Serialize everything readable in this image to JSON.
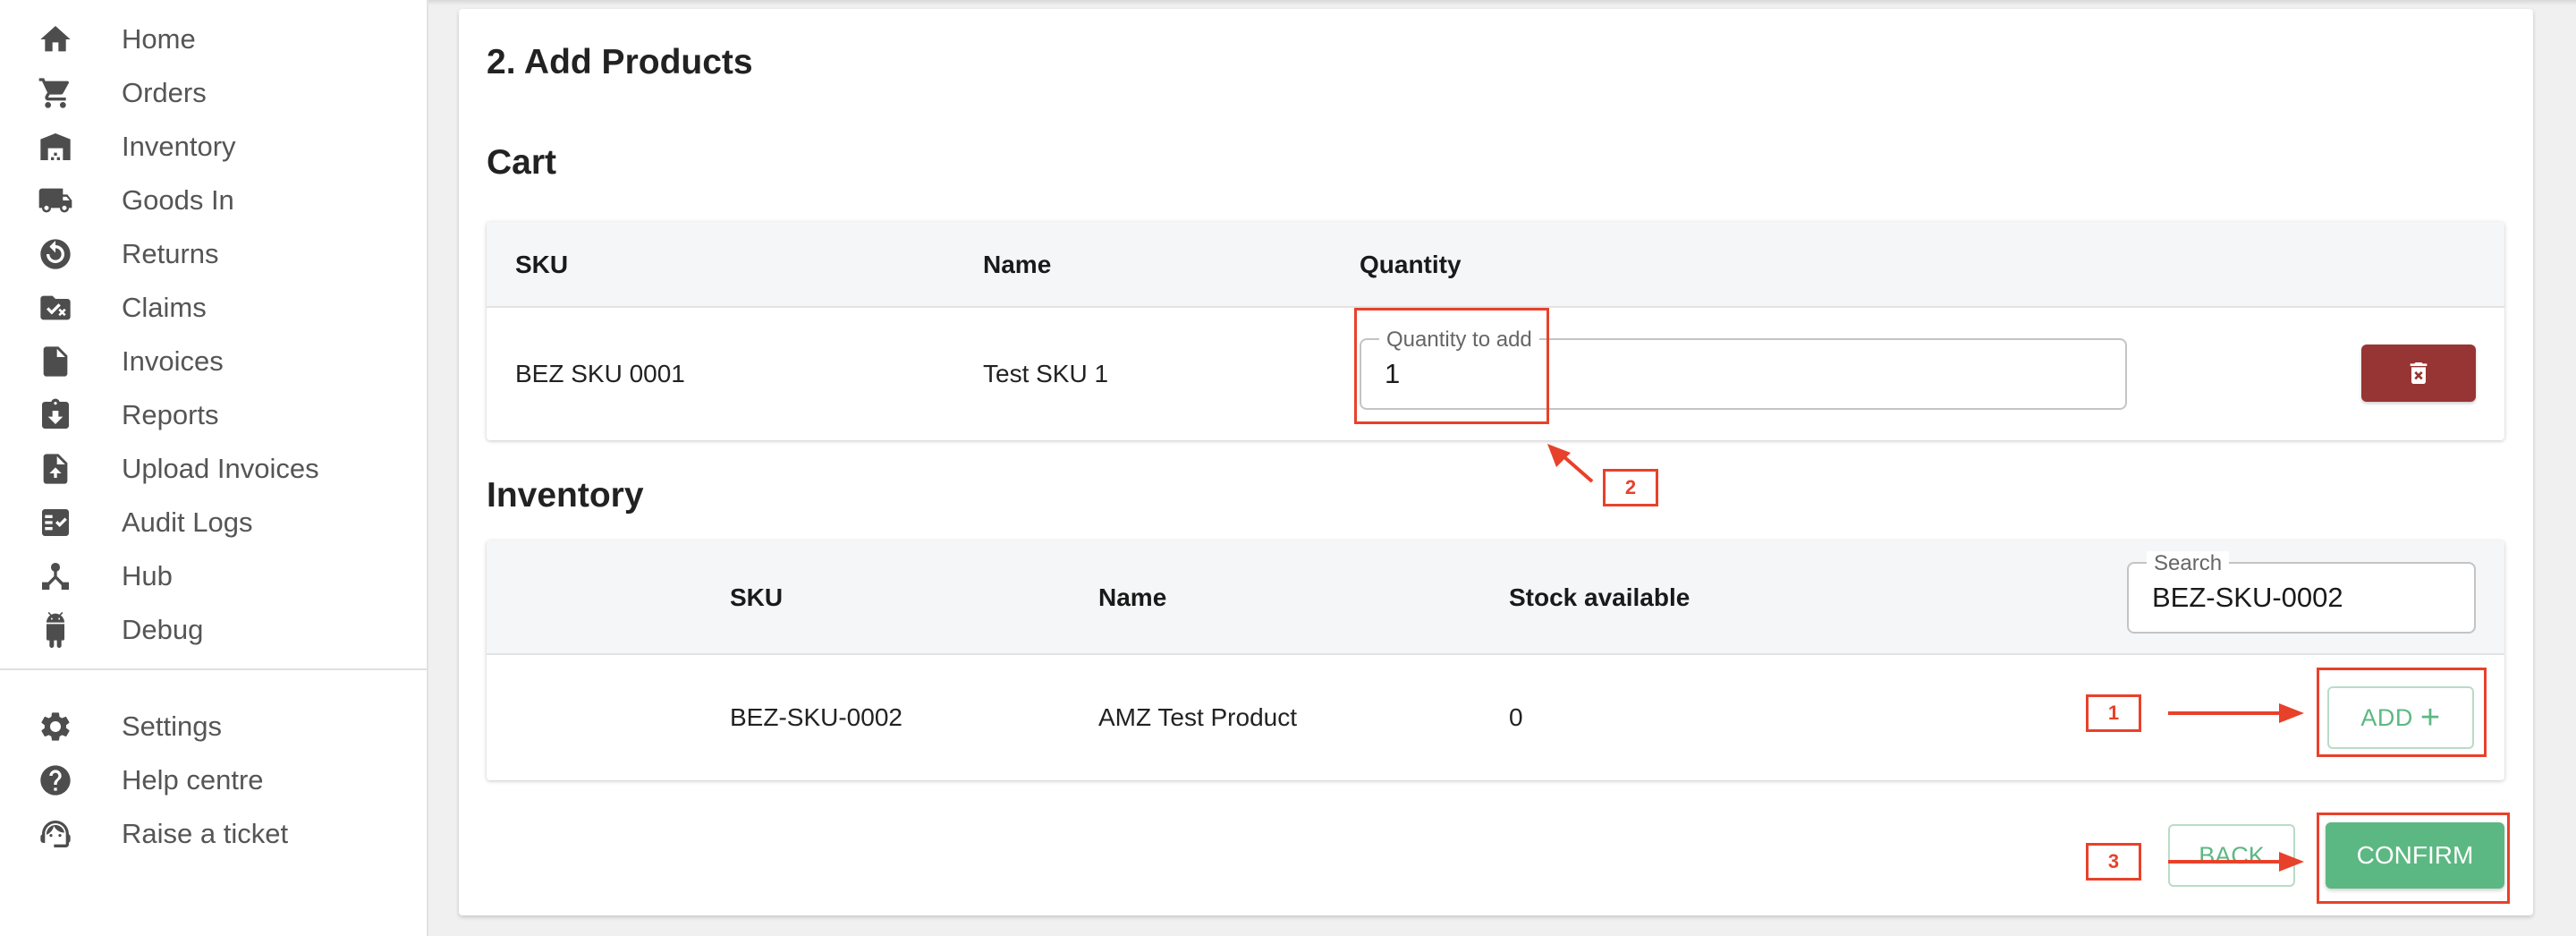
{
  "sidebar": {
    "items": [
      {
        "label": "Home",
        "icon": "home-icon"
      },
      {
        "label": "Orders",
        "icon": "cart-icon"
      },
      {
        "label": "Inventory",
        "icon": "warehouse-icon"
      },
      {
        "label": "Goods In",
        "icon": "truck-icon"
      },
      {
        "label": "Returns",
        "icon": "returns-icon"
      },
      {
        "label": "Claims",
        "icon": "claims-folder-icon"
      },
      {
        "label": "Invoices",
        "icon": "document-icon"
      },
      {
        "label": "Reports",
        "icon": "clipboard-download-icon"
      },
      {
        "label": "Upload Invoices",
        "icon": "file-upload-icon"
      },
      {
        "label": "Audit Logs",
        "icon": "checklist-icon"
      },
      {
        "label": "Hub",
        "icon": "hub-icon"
      },
      {
        "label": "Debug",
        "icon": "android-icon"
      }
    ],
    "secondary_items": [
      {
        "label": "Settings",
        "icon": "gear-icon"
      },
      {
        "label": "Help centre",
        "icon": "help-icon"
      },
      {
        "label": "Raise a ticket",
        "icon": "support-agent-icon"
      }
    ]
  },
  "main": {
    "step_title": "2. Add Products",
    "cart": {
      "title": "Cart",
      "columns": [
        "SKU",
        "Name",
        "Quantity"
      ],
      "rows": [
        {
          "sku": "BEZ SKU 0001",
          "name": "Test SKU 1",
          "quantity_label": "Quantity to add",
          "quantity_value": "1"
        }
      ]
    },
    "inventory": {
      "title": "Inventory",
      "columns": [
        "SKU",
        "Name",
        "Stock available"
      ],
      "search": {
        "label": "Search",
        "value": "BEZ-SKU-0002"
      },
      "rows": [
        {
          "sku": "BEZ-SKU-0002",
          "name": "AMZ Test Product",
          "stock": "0",
          "add_label": "ADD"
        }
      ]
    },
    "actions": {
      "back_label": "BACK",
      "confirm_label": "CONFIRM"
    }
  },
  "annotations": [
    "1",
    "2",
    "3"
  ],
  "colors": {
    "accent_green": "#5cb882",
    "delete_red": "#973434",
    "annotation_red": "#e8412b"
  }
}
